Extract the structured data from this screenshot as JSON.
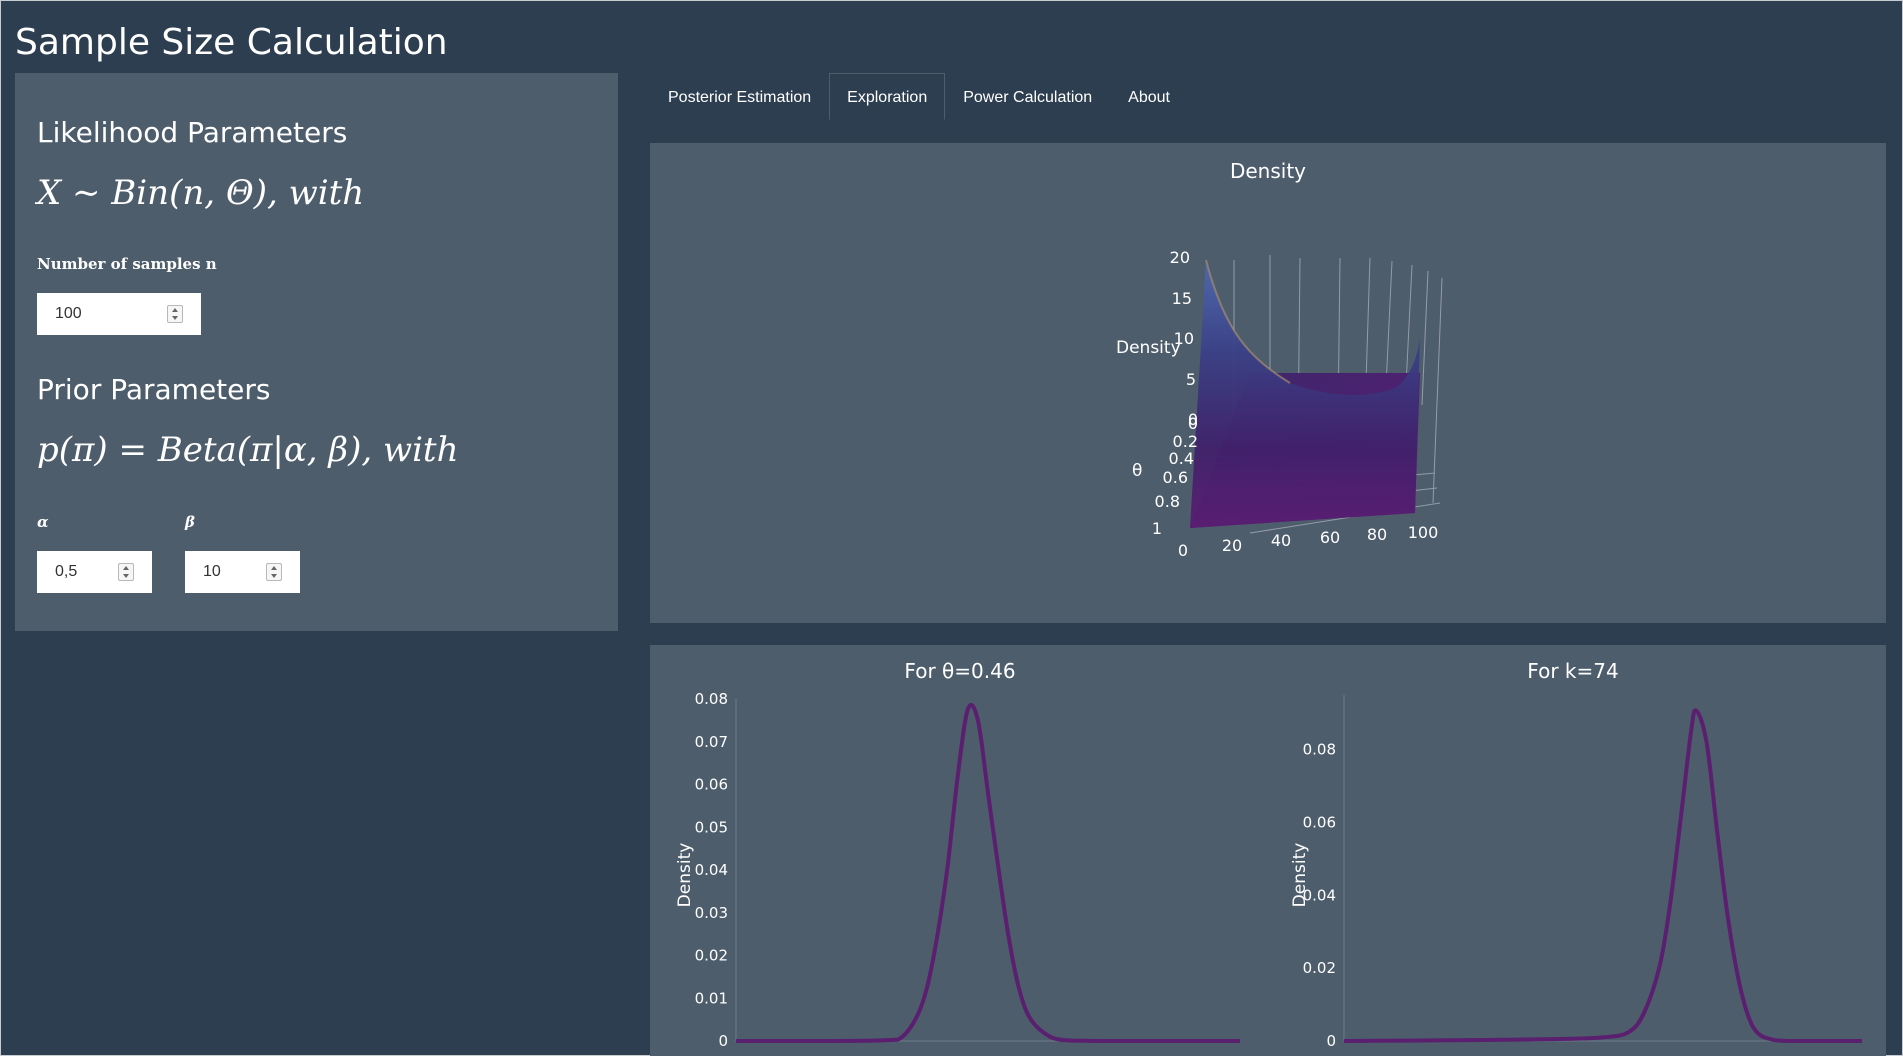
{
  "app": {
    "title": "Sample Size Calculation"
  },
  "sidebar": {
    "likelihood_heading": "Likelihood Parameters",
    "likelihood_formula": "X ∼ Bin(n, Θ), with",
    "n_label": "Number of samples n",
    "n_value": "100",
    "prior_heading": "Prior Parameters",
    "prior_formula": "p(π) = Beta(π|α, β), with",
    "alpha_label": "α",
    "alpha_value": "0,5",
    "beta_label": "β",
    "beta_value": "10"
  },
  "tabs": [
    {
      "label": "Posterior Estimation",
      "active": false
    },
    {
      "label": "Exploration",
      "active": true
    },
    {
      "label": "Power Calculation",
      "active": false
    },
    {
      "label": "About",
      "active": false
    }
  ],
  "colors": {
    "background": "#2c3e50",
    "panel": "#4e5d6c",
    "curve": "#5b1f6f",
    "surface_top": "#4b5a9c",
    "surface_bottom": "#5c1f74"
  },
  "density3d": {
    "title": "Density",
    "z_axis_label": "Density",
    "theta_axis_label": "θ",
    "z_ticks": [
      "20",
      "15",
      "10",
      "5",
      "0"
    ],
    "theta_ticks": [
      "0",
      "0.2",
      "0.4",
      "0.6",
      "0.8",
      "1"
    ],
    "k_ticks": [
      "0",
      "20",
      "40",
      "60",
      "80",
      "100"
    ]
  },
  "chart_data": [
    {
      "type": "line",
      "title": "For θ=0.46",
      "ylabel": "Density",
      "xlabel": "",
      "ylim": [
        0,
        0.08
      ],
      "yticks": [
        "0",
        "0.01",
        "0.02",
        "0.03",
        "0.04",
        "0.05",
        "0.06",
        "0.07",
        "0.08"
      ],
      "x_range": [
        0,
        100
      ],
      "peak": {
        "x": 46,
        "y": 0.0776
      },
      "series": [
        {
          "x": [
            0,
            10,
            20,
            30,
            33,
            36,
            38,
            40,
            42,
            44,
            46,
            48,
            50,
            52,
            54,
            56,
            58,
            61,
            65,
            75,
            100
          ],
          "y": [
            0,
            0,
            0,
            0.0002,
            0.001,
            0.006,
            0.013,
            0.025,
            0.041,
            0.062,
            0.0776,
            0.075,
            0.058,
            0.041,
            0.025,
            0.013,
            0.006,
            0.002,
            0.0002,
            0,
            0
          ]
        }
      ]
    },
    {
      "type": "line",
      "title": "For k=74",
      "ylabel": "Density",
      "xlabel": "",
      "ylim": [
        0,
        0.095
      ],
      "yticks": [
        "0",
        "0.02",
        "0.04",
        "0.06",
        "0.08"
      ],
      "x_range": [
        0,
        1
      ],
      "peak": {
        "x": 0.68,
        "y": 0.0907
      },
      "series": [
        {
          "x": [
            0,
            0.2,
            0.4,
            0.5,
            0.55,
            0.58,
            0.61,
            0.63,
            0.65,
            0.67,
            0.68,
            0.7,
            0.72,
            0.74,
            0.76,
            0.78,
            0.8,
            0.83,
            0.86,
            0.9,
            1
          ],
          "y": [
            0,
            0.0002,
            0.0005,
            0.001,
            0.0025,
            0.008,
            0.021,
            0.038,
            0.061,
            0.085,
            0.0907,
            0.082,
            0.058,
            0.035,
            0.018,
            0.007,
            0.002,
            0.0003,
            0,
            0,
            0
          ]
        }
      ]
    }
  ]
}
